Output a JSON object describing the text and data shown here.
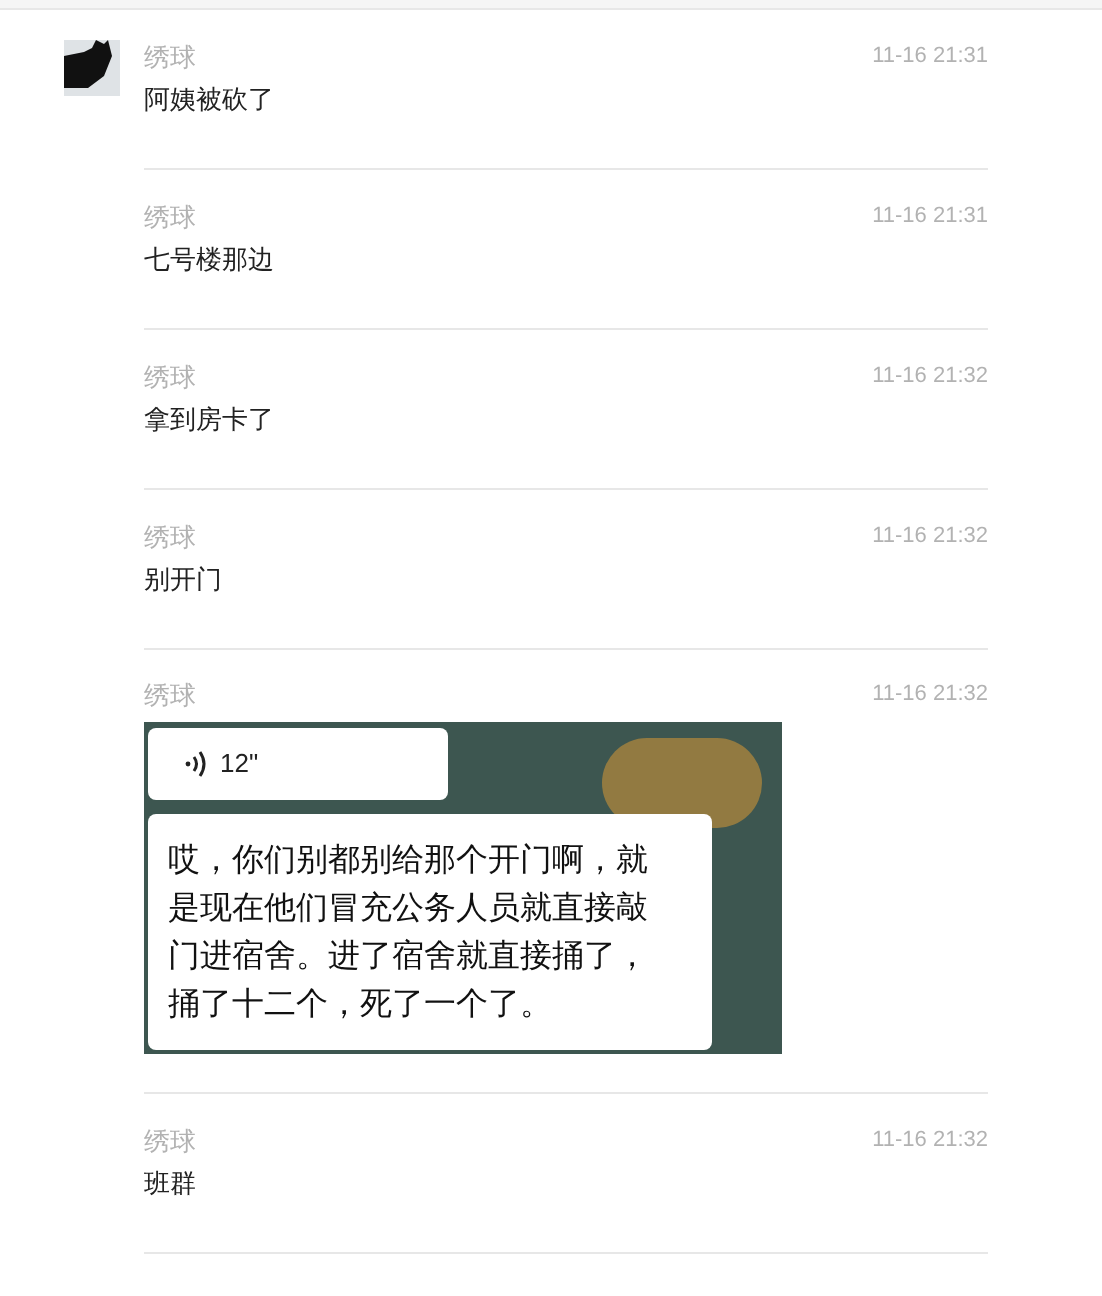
{
  "messages": [
    {
      "kind": "text",
      "sender": "绣球",
      "time": "11-16 21:31",
      "text": "阿姨被砍了",
      "avatar": true
    },
    {
      "kind": "text",
      "sender": "绣球",
      "time": "11-16 21:31",
      "text": "七号楼那边"
    },
    {
      "kind": "text",
      "sender": "绣球",
      "time": "11-16 21:32",
      "text": "拿到房卡了"
    },
    {
      "kind": "text",
      "sender": "绣球",
      "time": "11-16 21:32",
      "text": "别开门"
    },
    {
      "kind": "voice",
      "sender": "绣球",
      "time": "11-16 21:32",
      "duration": "12\"",
      "transcript": "哎，你们别都别给那个开门啊，就是现在他们冒充公务人员就直接敲门进宿舍。进了宿舍就直接捅了，捅了十二个，死了一个了。"
    },
    {
      "kind": "text",
      "sender": "绣球",
      "time": "11-16 21:32",
      "text": "班群"
    }
  ]
}
